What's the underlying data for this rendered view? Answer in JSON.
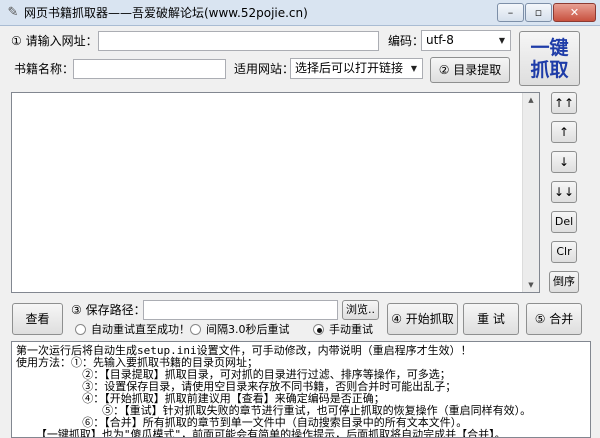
{
  "window": {
    "title": "网页书籍抓取器——吾爱破解论坛(www.52pojie.cn)",
    "minimize": "–",
    "restore": "▫",
    "close": "✕"
  },
  "form": {
    "url_label": "① 请输入网址：",
    "url_value": "",
    "encoding_label": "编码：",
    "encoding_value": "utf-8",
    "book_name_label": "书籍名称：",
    "book_name_value": "",
    "site_label": "适用网站：",
    "site_value": "选择后可以打开链接",
    "toc_button": "② 目录提取",
    "one_click_line1": "一键",
    "one_click_line2": "抓取"
  },
  "side_buttons": [
    "↑↑",
    "↑",
    "↓",
    "↓↓",
    "Del",
    "Clr",
    "倒序"
  ],
  "bottom": {
    "view_button": "查看",
    "save_path_label": "③ 保存路径：",
    "save_path_value": "",
    "browse_button": "浏览..",
    "start_button": "④ 开始抓取",
    "retry_button": "重 试",
    "merge_button": "⑤ 合并",
    "radio_auto": "自动重试直至成功！",
    "radio_interval": "间隔3.0秒后重试",
    "radio_manual": "手动重试",
    "selected_radio": "manual"
  },
  "log": [
    "第一次运行后将自动生成setup.ini设置文件，可手动修改，内带说明（重启程序才生效）！",
    "使用方法：①：先输入要抓取书籍的目录页网址；",
    "          ②：【目录提取】抓取目录，可对抓的目录进行过滤、排序等操作，可多选；",
    "          ③：设置保存目录，请使用空目录来存放不同书籍，否则合并时可能出乱子；",
    "          ④：【开始抓取】抓取前建议用【查看】来确定编码是否正确；",
    "             ⑤：【重试】针对抓取失败的章节进行重试，也可停止抓取的恢复操作（重启同样有效）。",
    "          ⑥：【合并】所有抓取的章节到单一文件中（自动搜索目录中的所有文本文件）。",
    "   【一键抓取】也为\"傻瓜模式\"，前面可能会有简单的操作提示，后面抓取将自动完成并【合并】。"
  ]
}
